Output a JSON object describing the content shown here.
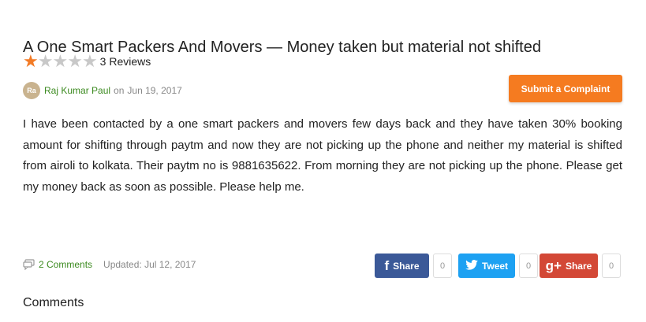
{
  "post": {
    "title": "A One Smart Packers And Movers — Money taken but material not shifted",
    "rating": 1,
    "max_rating": 5,
    "reviews_label": "3 Reviews",
    "avatar_initials": "Ra",
    "author": "Raj Kumar Paul",
    "on_word": "on",
    "date": "Jun 19, 2017",
    "body": "I have been contacted by a one smart packers and movers few days back and they have taken 30% booking amount for shifting through paytm and now they are not picking up the phone and neither my material is shifted from airoli to kolkata. Their paytm no is 9881635622. From morning they are not picking up the phone. Please get my money back as soon as possible. Please help me."
  },
  "actions": {
    "submit_label": "Submit a Complaint"
  },
  "footer": {
    "comments_link": "2 Comments",
    "updated": "Updated: Jul 12, 2017"
  },
  "share": {
    "facebook_label": "Share",
    "facebook_count": "0",
    "twitter_label": "Tweet",
    "twitter_count": "0",
    "gplus_label": "Share",
    "gplus_count": "0",
    "gplus_icon_text": "g+"
  },
  "comments_section": {
    "heading": "Comments"
  },
  "colors": {
    "accent": "#f57b20",
    "author_link": "#3b8a1f",
    "facebook": "#3b5998",
    "twitter": "#1da1f2",
    "gplus": "#d34836",
    "star_on": "#f27b26",
    "star_off": "#c8c8c8"
  },
  "icons": [
    "star-icon",
    "comment-icon",
    "facebook-icon",
    "twitter-icon",
    "gplus-icon"
  ]
}
